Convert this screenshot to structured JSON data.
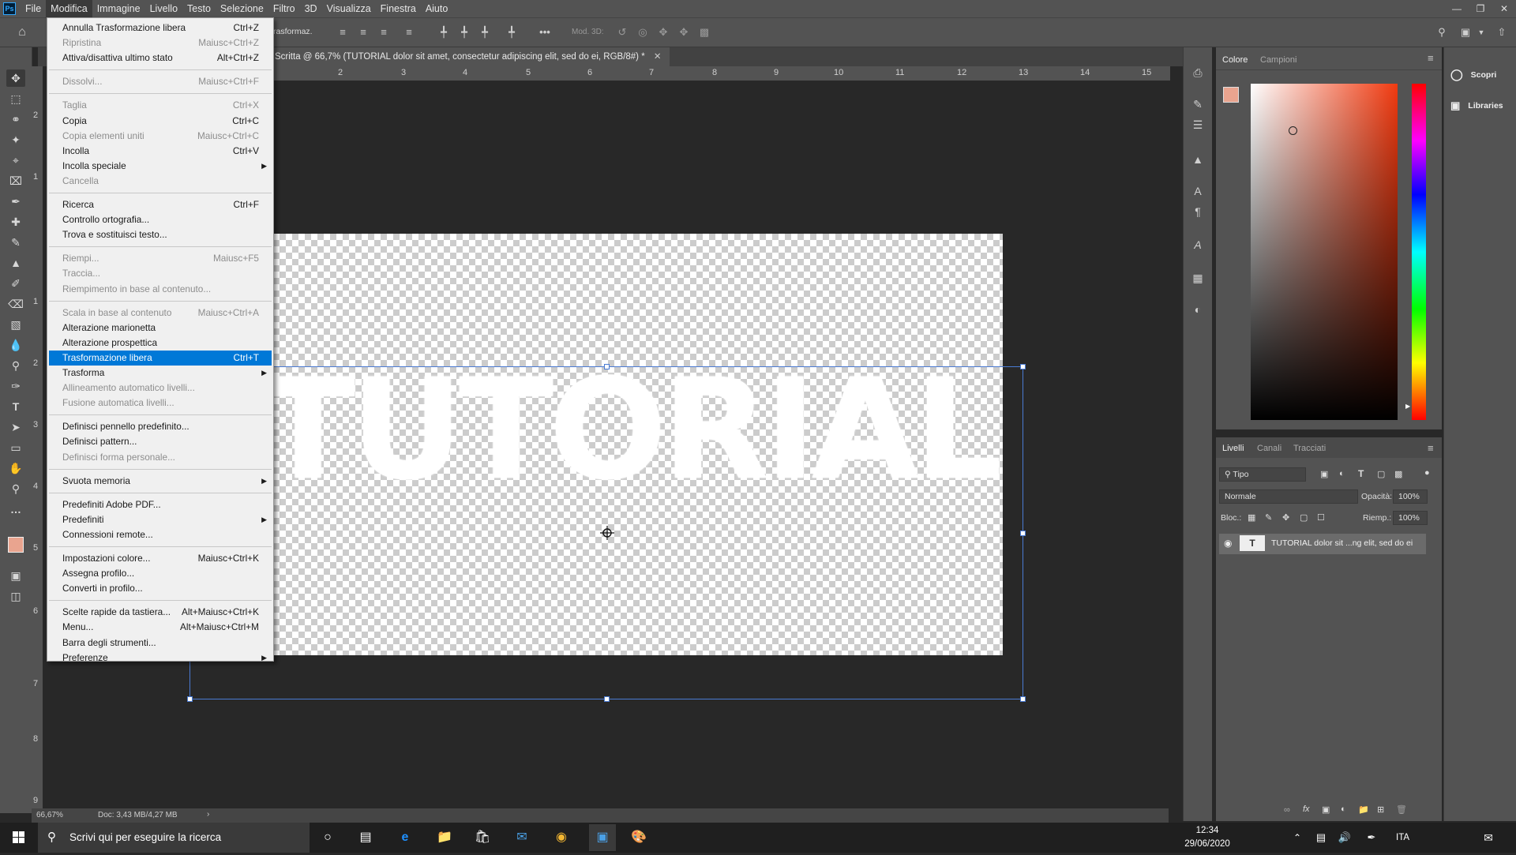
{
  "app": {
    "logo": "Ps"
  },
  "menubar": [
    "File",
    "Modifica",
    "Immagine",
    "Livello",
    "Testo",
    "Selezione",
    "Filtro",
    "3D",
    "Visualizza",
    "Finestra",
    "Aiuto"
  ],
  "optionsbar": {
    "partial_label": "rasformaz.",
    "mode3d_label": "Mod. 3D:"
  },
  "document": {
    "tab_title": "Scritta @ 66,7% (TUTORIAL dolor sit amet, consectetur adipiscing elit, sed do ei, RGB/8#) *",
    "canvas_text": "TUTORIAL"
  },
  "rulers": {
    "top": [
      "2",
      "3",
      "4",
      "5",
      "6",
      "7",
      "8",
      "9",
      "10",
      "11",
      "12",
      "13",
      "14",
      "15"
    ],
    "left": [
      "2",
      "1",
      "1",
      "2",
      "3",
      "4",
      "5",
      "6",
      "7",
      "8",
      "9"
    ]
  },
  "status": {
    "zoom": "66,67%",
    "doc": "Doc: 3,43 MB/4,27 MB"
  },
  "edit_menu": [
    {
      "label": "Annulla Trasformazione libera",
      "shortcut": "Ctrl+Z"
    },
    {
      "label": "Ripristina",
      "shortcut": "Maiusc+Ctrl+Z",
      "disabled": true
    },
    {
      "label": "Attiva/disattiva ultimo stato",
      "shortcut": "Alt+Ctrl+Z"
    },
    {
      "sep": true
    },
    {
      "label": "Dissolvi...",
      "shortcut": "Maiusc+Ctrl+F",
      "disabled": true
    },
    {
      "sep": true
    },
    {
      "label": "Taglia",
      "shortcut": "Ctrl+X",
      "disabled": true
    },
    {
      "label": "Copia",
      "shortcut": "Ctrl+C"
    },
    {
      "label": "Copia elementi uniti",
      "shortcut": "Maiusc+Ctrl+C",
      "disabled": true
    },
    {
      "label": "Incolla",
      "shortcut": "Ctrl+V"
    },
    {
      "label": "Incolla speciale",
      "submenu": true
    },
    {
      "label": "Cancella",
      "disabled": true
    },
    {
      "sep": true
    },
    {
      "label": "Ricerca",
      "shortcut": "Ctrl+F"
    },
    {
      "label": "Controllo ortografia..."
    },
    {
      "label": "Trova e sostituisci testo..."
    },
    {
      "sep": true
    },
    {
      "label": "Riempi...",
      "shortcut": "Maiusc+F5",
      "disabled": true
    },
    {
      "label": "Traccia...",
      "disabled": true
    },
    {
      "label": "Riempimento in base al contenuto...",
      "disabled": true
    },
    {
      "sep": true
    },
    {
      "label": "Scala in base al contenuto",
      "shortcut": "Maiusc+Ctrl+A",
      "disabled": true
    },
    {
      "label": "Alterazione marionetta"
    },
    {
      "label": "Alterazione prospettica"
    },
    {
      "label": "Trasformazione libera",
      "shortcut": "Ctrl+T",
      "highlighted": true
    },
    {
      "label": "Trasforma",
      "submenu": true
    },
    {
      "label": "Allineamento automatico livelli...",
      "disabled": true
    },
    {
      "label": "Fusione automatica livelli...",
      "disabled": true
    },
    {
      "sep": true
    },
    {
      "label": "Definisci pennello predefinito..."
    },
    {
      "label": "Definisci pattern..."
    },
    {
      "label": "Definisci forma personale...",
      "disabled": true
    },
    {
      "sep": true
    },
    {
      "label": "Svuota memoria",
      "submenu": true
    },
    {
      "sep": true
    },
    {
      "label": "Predefiniti Adobe PDF..."
    },
    {
      "label": "Predefiniti",
      "submenu": true
    },
    {
      "label": "Connessioni remote..."
    },
    {
      "sep": true
    },
    {
      "label": "Impostazioni colore...",
      "shortcut": "Maiusc+Ctrl+K"
    },
    {
      "label": "Assegna profilo..."
    },
    {
      "label": "Converti in profilo..."
    },
    {
      "sep": true
    },
    {
      "label": "Scelte rapide da tastiera...",
      "shortcut": "Alt+Maiusc+Ctrl+K"
    },
    {
      "label": "Menu...",
      "shortcut": "Alt+Maiusc+Ctrl+M"
    },
    {
      "label": "Barra degli strumenti..."
    },
    {
      "label": "Preferenze",
      "submenu": true
    }
  ],
  "color_panel": {
    "tabs": [
      "Colore",
      "Campioni"
    ],
    "foreground": "#e9a48f",
    "background": "#5a5a5a"
  },
  "layers_panel": {
    "tabs": [
      "Livelli",
      "Canali",
      "Tracciati"
    ],
    "filter": "Tipo",
    "blend_mode": "Normale",
    "opacity_label": "Opacità:",
    "opacity": "100%",
    "lock_label": "Bloc.:",
    "fill_label": "Riemp.:",
    "fill": "100%",
    "layer_name": "TUTORIAL dolor sit ...ng elit, sed do ei"
  },
  "right_panel": {
    "discover": "Scopri",
    "libraries": "Libraries"
  },
  "taskbar": {
    "search_placeholder": "Scrivi qui per eseguire la ricerca",
    "lang": "ITA",
    "time": "12:34",
    "date": "29/06/2020"
  },
  "colors": {
    "accent": "#0078d7",
    "transform": "#4a7bd3"
  }
}
